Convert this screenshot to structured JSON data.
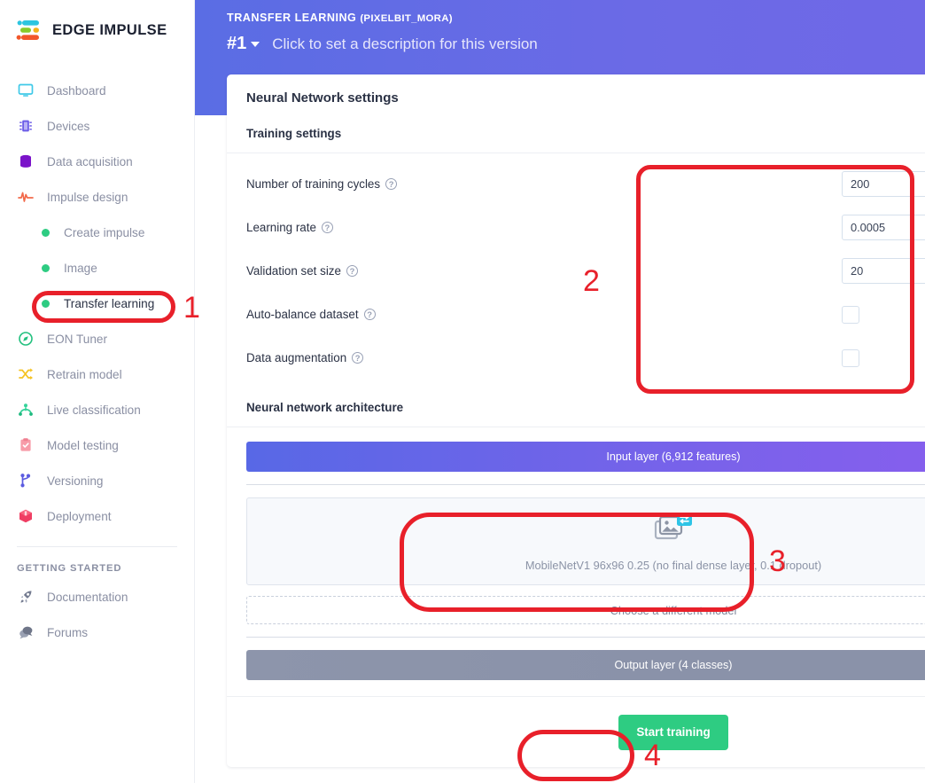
{
  "brand": {
    "name": "EDGE IMPULSE",
    "logo_icon": "edge-impulse-logo"
  },
  "sidebar": {
    "items": [
      {
        "label": "Dashboard",
        "icon": "monitor-icon"
      },
      {
        "label": "Devices",
        "icon": "chip-icon"
      },
      {
        "label": "Data acquisition",
        "icon": "database-icon"
      },
      {
        "label": "Impulse design",
        "icon": "waveform-icon"
      }
    ],
    "sub_items": [
      {
        "label": "Create impulse",
        "icon": "green-dot-icon",
        "active": false
      },
      {
        "label": "Image",
        "icon": "green-dot-icon",
        "active": false
      },
      {
        "label": "Transfer learning",
        "icon": "green-dot-icon",
        "active": true
      }
    ],
    "items2": [
      {
        "label": "EON Tuner",
        "icon": "compass-icon"
      },
      {
        "label": "Retrain model",
        "icon": "shuffle-icon"
      },
      {
        "label": "Live classification",
        "icon": "antenna-icon"
      },
      {
        "label": "Model testing",
        "icon": "clipboard-check-icon"
      },
      {
        "label": "Versioning",
        "icon": "git-branch-icon"
      },
      {
        "label": "Deployment",
        "icon": "box-icon"
      }
    ],
    "getting_started_title": "GETTING STARTED",
    "getting_started": [
      {
        "label": "Documentation",
        "icon": "rocket-icon"
      },
      {
        "label": "Forums",
        "icon": "chat-bubble-icon"
      }
    ]
  },
  "header": {
    "kicker": "TRANSFER LEARNING",
    "project": "(PIXELBIT_MORA)",
    "version": "#1",
    "version_description": "Click to set a description for this version"
  },
  "card": {
    "title": "Neural Network settings",
    "menu_icon": "kebab-menu-icon",
    "training_section_title": "Training settings",
    "fields": [
      {
        "label": "Number of training cycles",
        "help_icon": "help-circle-icon",
        "type": "text",
        "value": "200",
        "suffix": ""
      },
      {
        "label": "Learning rate",
        "help_icon": "help-circle-icon",
        "type": "text",
        "value": "0.0005",
        "suffix": ""
      },
      {
        "label": "Validation set size",
        "help_icon": "help-circle-icon",
        "type": "text",
        "value": "20",
        "suffix": "%"
      },
      {
        "label": "Auto-balance dataset",
        "help_icon": "help-circle-icon",
        "type": "checkbox",
        "value": "",
        "suffix": ""
      },
      {
        "label": "Data augmentation",
        "help_icon": "help-circle-icon",
        "type": "checkbox",
        "value": "",
        "suffix": ""
      }
    ],
    "arch_section_title": "Neural network architecture",
    "input_layer": "Input layer (6,912 features)",
    "model_icon": "transfer-image-icon",
    "model_label": "MobileNetV1 96x96 0.25 (no final dense layer, 0.1 dropout)",
    "choose_model": "Choose a different model",
    "output_layer": "Output layer (4 classes)",
    "start_training": "Start training"
  },
  "annotations": {
    "color": "#e8202a",
    "markers": [
      {
        "number": "1",
        "target": "sidebar-item-transfer-learning"
      },
      {
        "number": "2",
        "target": "training-settings-fields"
      },
      {
        "number": "3",
        "target": "model-selection-box"
      },
      {
        "number": "4",
        "target": "start-training-button"
      }
    ]
  }
}
